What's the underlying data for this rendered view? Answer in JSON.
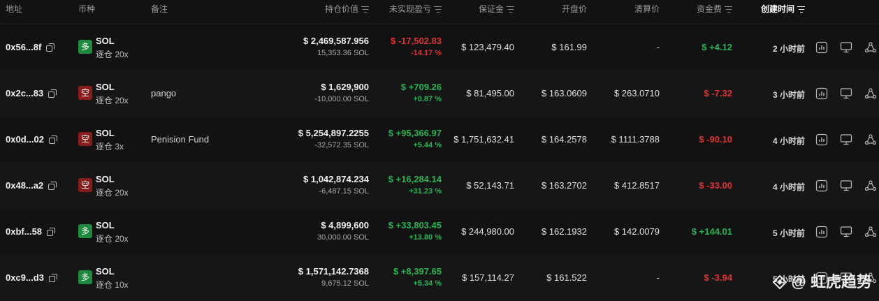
{
  "headers": {
    "address": "地址",
    "coin": "币种",
    "note": "备注",
    "position_value": "持仓价值",
    "unrealized_pnl": "未实现盈亏",
    "margin": "保证金",
    "open_price": "开盘价",
    "liq_price": "清算价",
    "funding_fee": "资金费",
    "created_time": "创建时间"
  },
  "colors": {
    "positive": "#26b553",
    "negative": "#e03333",
    "long_badge": "#1e8a3e",
    "short_badge": "#8a1c1c"
  },
  "rows": [
    {
      "address": "0x56...8f",
      "side": "多",
      "coin": "SOL",
      "margin_type": "逐仓 20x",
      "note": "",
      "value": "$ 2,469,587.956",
      "size": "15,353.36 SOL",
      "pnl": "$ -17,502.83",
      "pnl_pct": "-14.17 %",
      "pnl_sign": "neg",
      "margin": "$ 123,479.40",
      "open": "$ 161.99",
      "liq": "-",
      "fee": "$ +4.12",
      "fee_sign": "pos",
      "time": "2 小时前"
    },
    {
      "address": "0x2c...83",
      "side": "空",
      "coin": "SOL",
      "margin_type": "逐仓 20x",
      "note": "pango",
      "value": "$ 1,629,900",
      "size": "-10,000.00 SOL",
      "pnl": "$ +709.26",
      "pnl_pct": "+0.87 %",
      "pnl_sign": "pos",
      "margin": "$ 81,495.00",
      "open": "$ 163.0609",
      "liq": "$ 263.0710",
      "fee": "$ -7.32",
      "fee_sign": "neg",
      "time": "3 小时前"
    },
    {
      "address": "0x0d...02",
      "side": "空",
      "coin": "SOL",
      "margin_type": "逐仓 3x",
      "note": "Penision Fund",
      "value": "$ 5,254,897.2255",
      "size": "-32,572.35 SOL",
      "pnl": "$ +95,366.97",
      "pnl_pct": "+5.44 %",
      "pnl_sign": "pos",
      "margin": "$ 1,751,632.41",
      "open": "$ 164.2578",
      "liq": "$ 1111.3788",
      "fee": "$ -90.10",
      "fee_sign": "neg",
      "time": "4 小时前"
    },
    {
      "address": "0x48...a2",
      "side": "空",
      "coin": "SOL",
      "margin_type": "逐仓 20x",
      "note": "",
      "value": "$ 1,042,874.234",
      "size": "-6,487.15 SOL",
      "pnl": "$ +16,284.14",
      "pnl_pct": "+31.23 %",
      "pnl_sign": "pos",
      "margin": "$ 52,143.71",
      "open": "$ 163.2702",
      "liq": "$ 412.8517",
      "fee": "$ -33.00",
      "fee_sign": "neg",
      "time": "4 小时前"
    },
    {
      "address": "0xbf...58",
      "side": "多",
      "coin": "SOL",
      "margin_type": "逐仓 20x",
      "note": "",
      "value": "$ 4,899,600",
      "size": "30,000.00 SOL",
      "pnl": "$ +33,803.45",
      "pnl_pct": "+13.80 %",
      "pnl_sign": "pos",
      "margin": "$ 244,980.00",
      "open": "$ 162.1932",
      "liq": "$ 142.0079",
      "fee": "$ +144.01",
      "fee_sign": "pos",
      "time": "5 小时前"
    },
    {
      "address": "0xc9...d3",
      "side": "多",
      "coin": "SOL",
      "margin_type": "逐仓 10x",
      "note": "",
      "value": "$ 1,571,142.7368",
      "size": "9,675.12 SOL",
      "pnl": "$ +8,397.65",
      "pnl_pct": "+5.34 %",
      "pnl_sign": "pos",
      "margin": "$ 157,114.27",
      "open": "$ 161.522",
      "liq": "-",
      "fee": "$ -3.94",
      "fee_sign": "neg",
      "time": "5 小时前"
    }
  ],
  "watermark": "@ 虹虎趋势"
}
